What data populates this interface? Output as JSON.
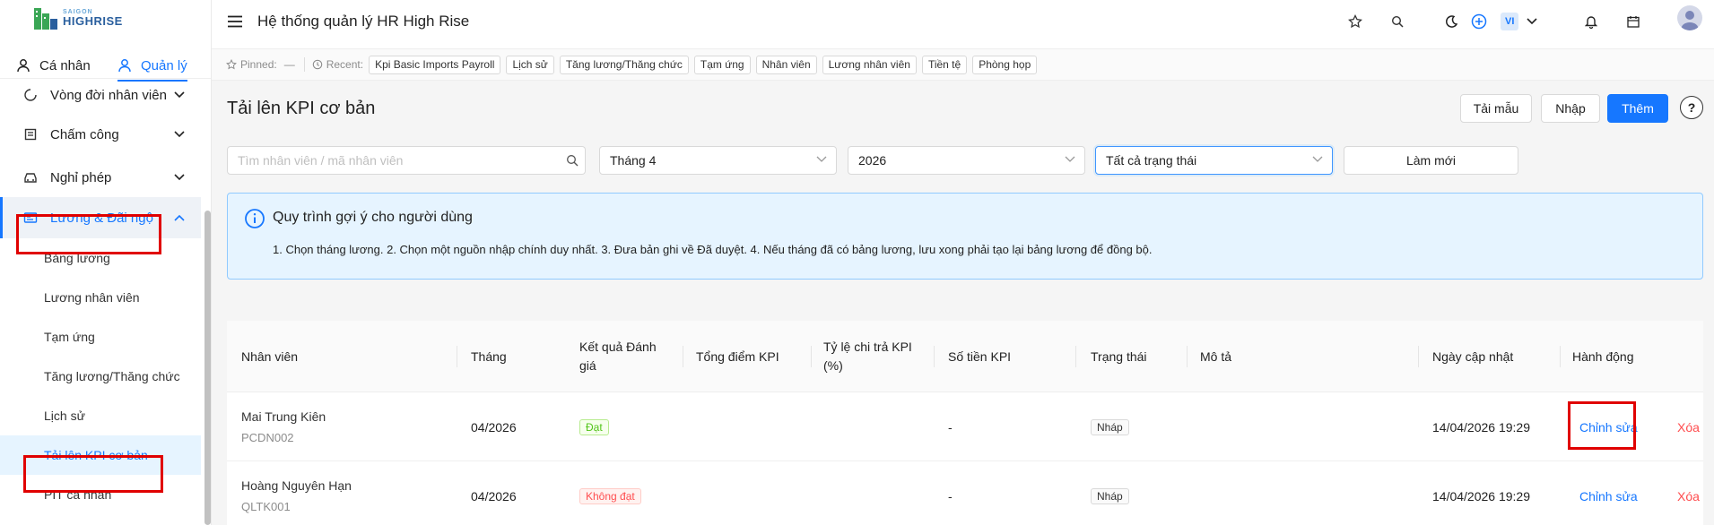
{
  "brand": {
    "logo_small": "SAIGON",
    "logo_big": "HIGHRISE"
  },
  "sidebar": {
    "mode_tabs": [
      {
        "label": "Cá nhân",
        "icon": "user-icon"
      },
      {
        "label": "Quản lý",
        "icon": "user-icon"
      }
    ],
    "menu": [
      {
        "label": "Vòng đời nhân viên",
        "icon": "lifecycle-icon"
      },
      {
        "label": "Chấm công",
        "icon": "timesheet-icon"
      },
      {
        "label": "Nghỉ phép",
        "icon": "car-icon"
      },
      {
        "label": "Lương & Đãi ngộ",
        "icon": "salary-icon"
      }
    ],
    "sub_items": [
      {
        "label": "Bảng lương"
      },
      {
        "label": "Lương nhân viên"
      },
      {
        "label": "Tạm ứng"
      },
      {
        "label": "Tăng lương/Thăng chức"
      },
      {
        "label": "Lịch sử"
      },
      {
        "label": "Tải lên KPI cơ bản"
      },
      {
        "label": "PIT cá nhân"
      }
    ]
  },
  "header": {
    "title": "Hệ thống quản lý HR High Rise",
    "lang": "VI"
  },
  "pinbar": {
    "pinned_label": "Pinned:",
    "pinned_value": "—",
    "recent_label": "Recent:",
    "recent": [
      "Kpi Basic Imports Payroll",
      "Lịch sử",
      "Tăng lương/Thăng chức",
      "Tạm ứng",
      "Nhân viên",
      "Lương nhân viên",
      "Tiền tệ",
      "Phòng họp"
    ]
  },
  "page": {
    "title": "Tải lên KPI cơ bản",
    "actions": {
      "template": "Tải mẫu",
      "import": "Nhập",
      "add": "Thêm",
      "help": "?"
    }
  },
  "filters": {
    "search_placeholder": "Tìm nhân viên / mã nhân viên",
    "month": "Tháng 4",
    "year": "2026",
    "status": "Tất cả trạng thái",
    "refresh": "Làm mới"
  },
  "notice": {
    "title": "Quy trình gợi ý cho người dùng",
    "body": "1. Chọn tháng lương. 2. Chọn một nguồn nhập chính duy nhất. 3. Đưa bản ghi về Đã duyệt. 4. Nếu tháng đã có bảng lương, lưu xong phải tạo lại bảng lương để đồng bộ."
  },
  "table": {
    "columns": {
      "employee": "Nhân viên",
      "month": "Tháng",
      "result": "Kết quả Đánh giá",
      "total": "Tổng điểm KPI",
      "ratio": "Tỷ lệ chi trả KPI (%)",
      "amount": "Số tiền KPI",
      "status": "Trạng thái",
      "desc": "Mô tả",
      "updated": "Ngày cập nhật",
      "actions": "Hành động"
    },
    "rows": [
      {
        "name": "Mai Trung Kiên",
        "code": "PCDN002",
        "month": "04/2026",
        "result": "Đạt",
        "total": "",
        "ratio": "",
        "amount": "-",
        "status": "Nháp",
        "desc": "",
        "updated": "14/04/2026 19:29",
        "edit": "Chỉnh sửa",
        "delete": "Xóa"
      },
      {
        "name": "Hoàng Nguyên Hạn",
        "code": "QLTK001",
        "month": "04/2026",
        "result": "Không đạt",
        "total": "",
        "ratio": "",
        "amount": "-",
        "status": "Nháp",
        "desc": "",
        "updated": "14/04/2026 19:29",
        "edit": "Chỉnh sửa",
        "delete": "Xóa"
      }
    ]
  },
  "colors": {
    "primary": "#1677ff",
    "highlight_box": "#e00000",
    "notice_bg": "#e6f4ff"
  }
}
